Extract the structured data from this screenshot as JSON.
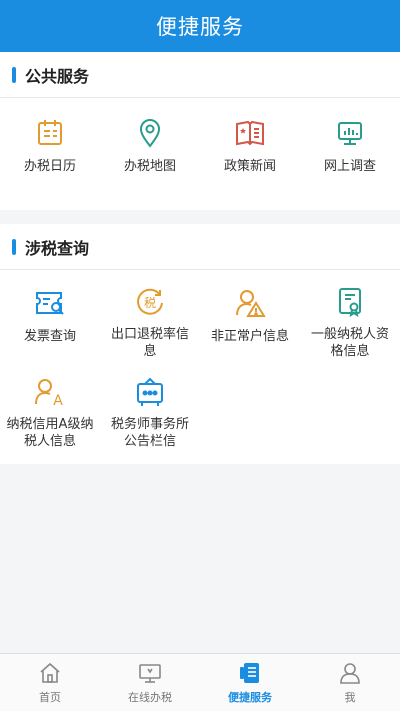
{
  "header": {
    "title": "便捷服务"
  },
  "sections": [
    {
      "title": "公共服务",
      "items": [
        {
          "label": "办税日历",
          "icon": "calendar-icon"
        },
        {
          "label": "办税地图",
          "icon": "map-pin-icon"
        },
        {
          "label": "政策新闻",
          "icon": "book-news-icon"
        },
        {
          "label": "网上调查",
          "icon": "survey-monitor-icon"
        }
      ]
    },
    {
      "title": "涉税查询",
      "items": [
        {
          "label": "发票查询",
          "icon": "invoice-search-icon"
        },
        {
          "label": "出口退税率信息",
          "icon": "tax-refund-icon"
        },
        {
          "label": "非正常户信息",
          "icon": "abnormal-user-icon"
        },
        {
          "label": "一般纳税人资格信息",
          "icon": "certificate-icon"
        },
        {
          "label": "纳税信用A级纳税人信息",
          "icon": "credit-a-icon"
        },
        {
          "label": "税务师事务所公告栏信",
          "icon": "bulletin-board-icon"
        }
      ]
    }
  ],
  "tabbar": {
    "tabs": [
      {
        "label": "首页",
        "icon": "home-icon"
      },
      {
        "label": "在线办税",
        "icon": "monitor-icon"
      },
      {
        "label": "便捷服务",
        "icon": "service-icon"
      },
      {
        "label": "我",
        "icon": "user-icon"
      }
    ],
    "active_index": 2
  },
  "colors": {
    "accent": "#1a8de0",
    "orange": "#e39a2f",
    "teal": "#2a9c8e",
    "red": "#d2584a"
  }
}
